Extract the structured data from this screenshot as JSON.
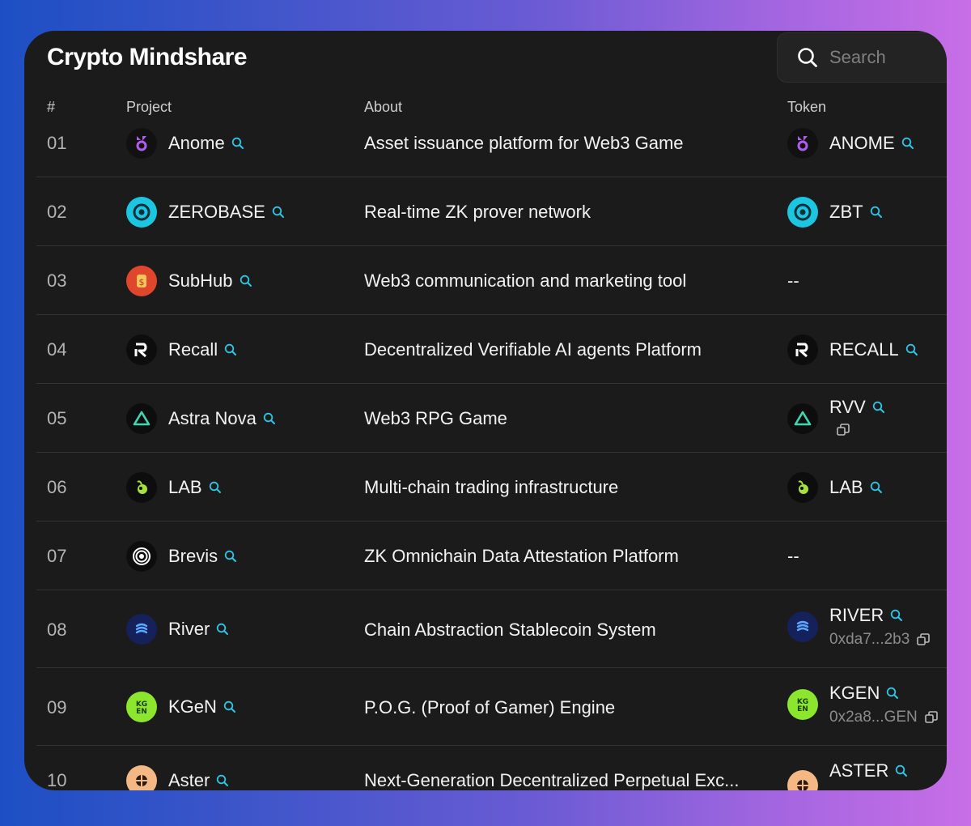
{
  "app": {
    "title": "Crypto Mindshare"
  },
  "search": {
    "placeholder": "Search"
  },
  "columns": {
    "num": "#",
    "project": "Project",
    "about": "About",
    "token": "Token"
  },
  "rows": [
    {
      "num": "01",
      "project": "Anome",
      "about": "Asset issuance platform for Web3 Game",
      "token": "ANOME",
      "address": "",
      "logo": "anome-logo"
    },
    {
      "num": "02",
      "project": "ZEROBASE",
      "about": "Real-time ZK prover network",
      "token": "ZBT",
      "address": "",
      "logo": "zerobase-logo"
    },
    {
      "num": "03",
      "project": "SubHub",
      "about": "Web3 communication and marketing tool",
      "token": "--",
      "address": "",
      "logo": "subhub-logo"
    },
    {
      "num": "04",
      "project": "Recall",
      "about": "Decentralized Verifiable AI agents Platform",
      "token": "RECALL",
      "address": "",
      "logo": "recall-logo"
    },
    {
      "num": "05",
      "project": "Astra Nova",
      "about": "Web3 RPG Game",
      "token": "RVV",
      "address": "",
      "logo": "astra-nova-logo"
    },
    {
      "num": "06",
      "project": "LAB",
      "about": "Multi-chain trading infrastructure",
      "token": "LAB",
      "address": "",
      "logo": "lab-logo"
    },
    {
      "num": "07",
      "project": "Brevis",
      "about": "ZK Omnichain Data Attestation Platform",
      "token": "--",
      "address": "",
      "logo": "brevis-logo"
    },
    {
      "num": "08",
      "project": "River",
      "about": "Chain Abstraction Stablecoin System",
      "token": "RIVER",
      "address": "0xda7...2b3",
      "logo": "river-logo"
    },
    {
      "num": "09",
      "project": "KGeN",
      "about": "P.O.G. (Proof of Gamer) Engine",
      "token": "KGEN",
      "address": "0x2a8...GEN",
      "logo": "kgen-logo"
    },
    {
      "num": "10",
      "project": "Aster",
      "about": "Next-Generation Decentralized Perpetual Exc...",
      "token": "ASTER",
      "address": "",
      "logo": "aster-logo"
    }
  ],
  "colors": {
    "accent": "#2ec6e6",
    "background": "#1b1b1b",
    "divider": "#333333"
  }
}
